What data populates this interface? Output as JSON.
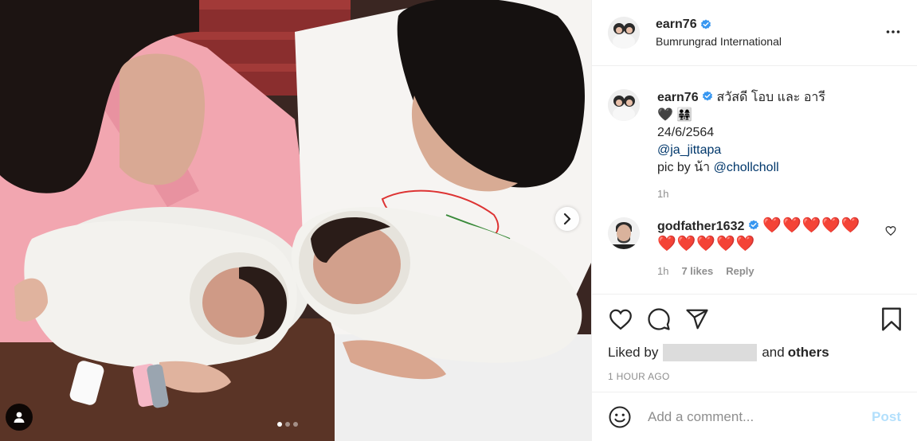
{
  "post": {
    "username": "earn76",
    "location": "Bumrungrad International"
  },
  "caption": {
    "username": "earn76",
    "text_line1": "สวัสดี โอบ และ อารี",
    "text_line2": "🖤 👨‍👩‍👧‍👧",
    "date": "24/6/2564",
    "mention": "@ja_jittapa",
    "pic_prefix": "pic by น้า",
    "pic_mention": "@chollcholl",
    "time": "1h"
  },
  "comment": {
    "username": "godfather1632",
    "hearts_line1": "❤️❤️❤️❤️❤️",
    "hearts_line2": "❤️❤️❤️❤️❤️",
    "time": "1h",
    "likes": "7 likes",
    "reply": "Reply"
  },
  "likes": {
    "prefix": "Liked by",
    "suffix_and": "and",
    "others": "others"
  },
  "timestamp": "1 HOUR AGO",
  "add_comment": {
    "placeholder": "Add a comment...",
    "post_label": "Post"
  },
  "carousel": {
    "total": 3,
    "active": 1
  },
  "colors": {
    "verified": "#3897f0",
    "heart": "#ed1c24",
    "link": "#00376b",
    "post_disabled": "#b2dffc"
  }
}
